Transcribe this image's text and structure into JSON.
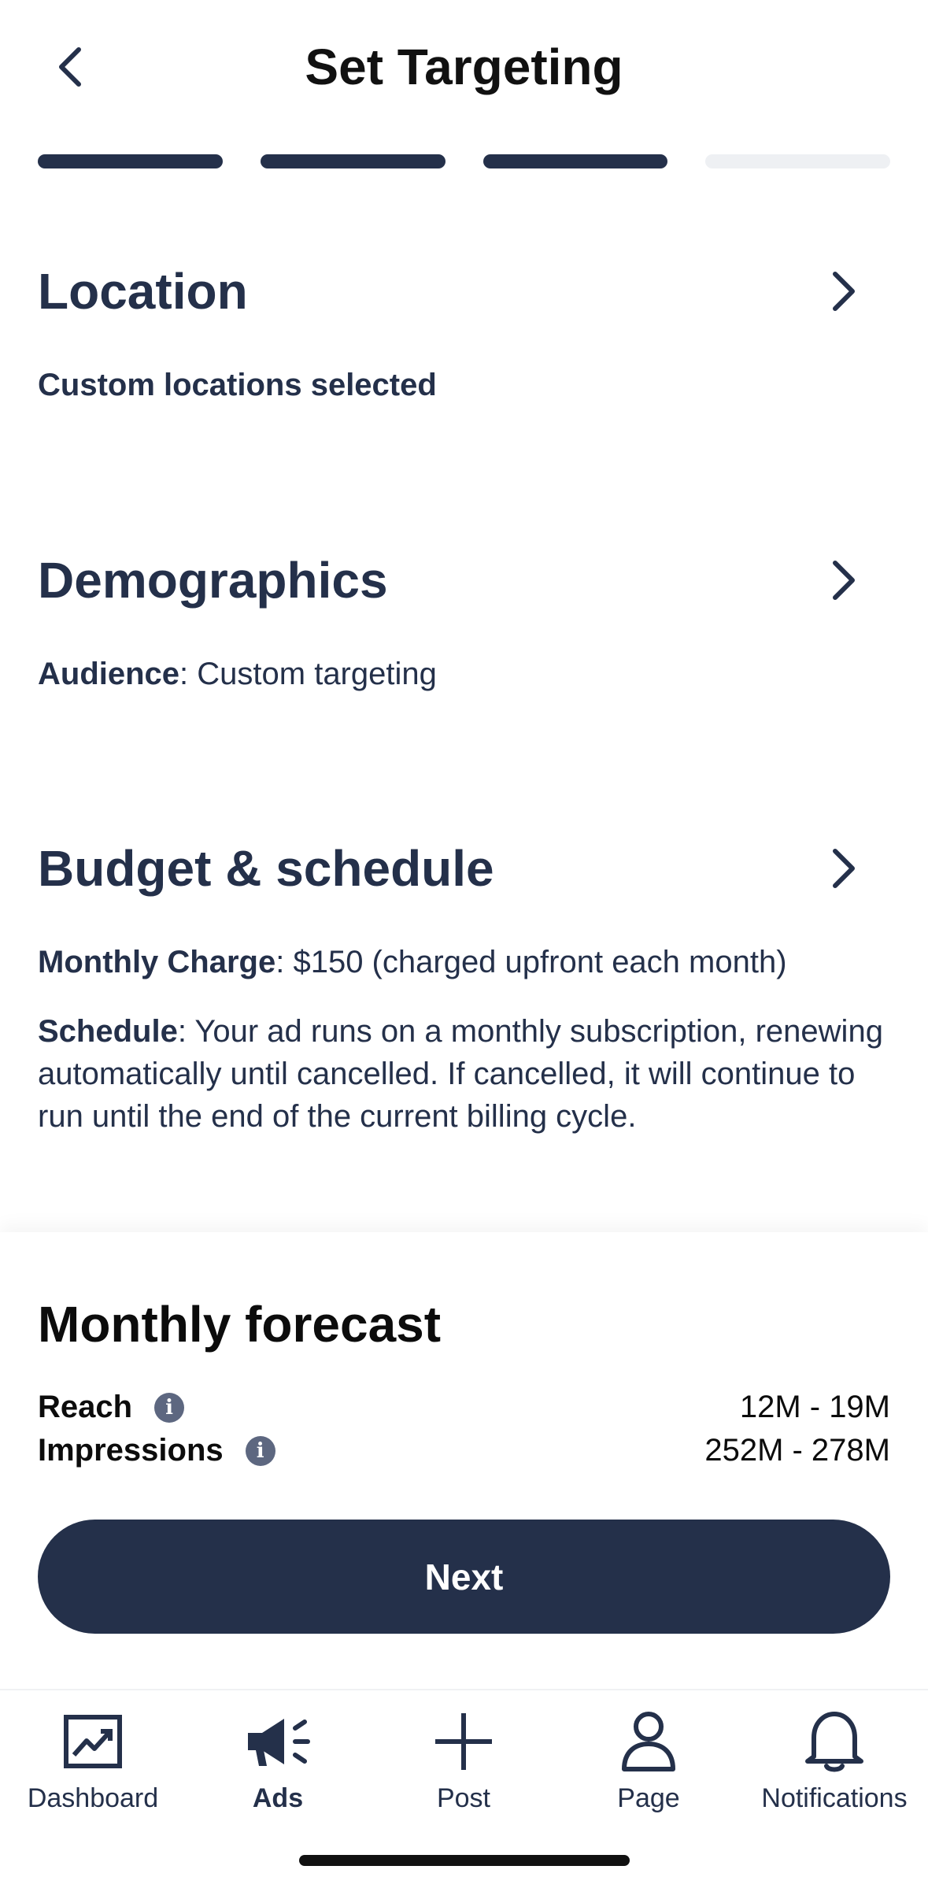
{
  "header": {
    "title": "Set Targeting"
  },
  "progress": {
    "total_steps": 4,
    "completed_steps": 3
  },
  "sections": {
    "location": {
      "title": "Location",
      "text": "Custom locations selected"
    },
    "demographics": {
      "title": "Demographics",
      "audience_label": "Audience",
      "audience_value": ": Custom targeting"
    },
    "budget": {
      "title": "Budget & schedule",
      "charge_label": "Monthly Charge",
      "charge_value": ": $150 (charged upfront each month)",
      "schedule_label": "Schedule",
      "schedule_value": ": Your ad runs on a monthly subscription, renewing automatically until cancelled. If cancelled, it will continue to run until the end of the current billing cycle."
    }
  },
  "forecast": {
    "title": "Monthly forecast",
    "reach_label": "Reach",
    "reach_value": "12M - 19M",
    "impressions_label": "Impressions",
    "impressions_value": "252M - 278M",
    "info_glyph": "i"
  },
  "next_label": "Next",
  "tabs": [
    {
      "label": "Dashboard",
      "icon": "chart-icon"
    },
    {
      "label": "Ads",
      "icon": "megaphone-icon",
      "active": true
    },
    {
      "label": "Post",
      "icon": "plus-icon"
    },
    {
      "label": "Page",
      "icon": "person-icon"
    },
    {
      "label": "Notifications",
      "icon": "bell-icon"
    }
  ],
  "colors": {
    "primary": "#24304a",
    "progress_inactive": "#eef0f3",
    "info_icon": "#5d6780"
  }
}
